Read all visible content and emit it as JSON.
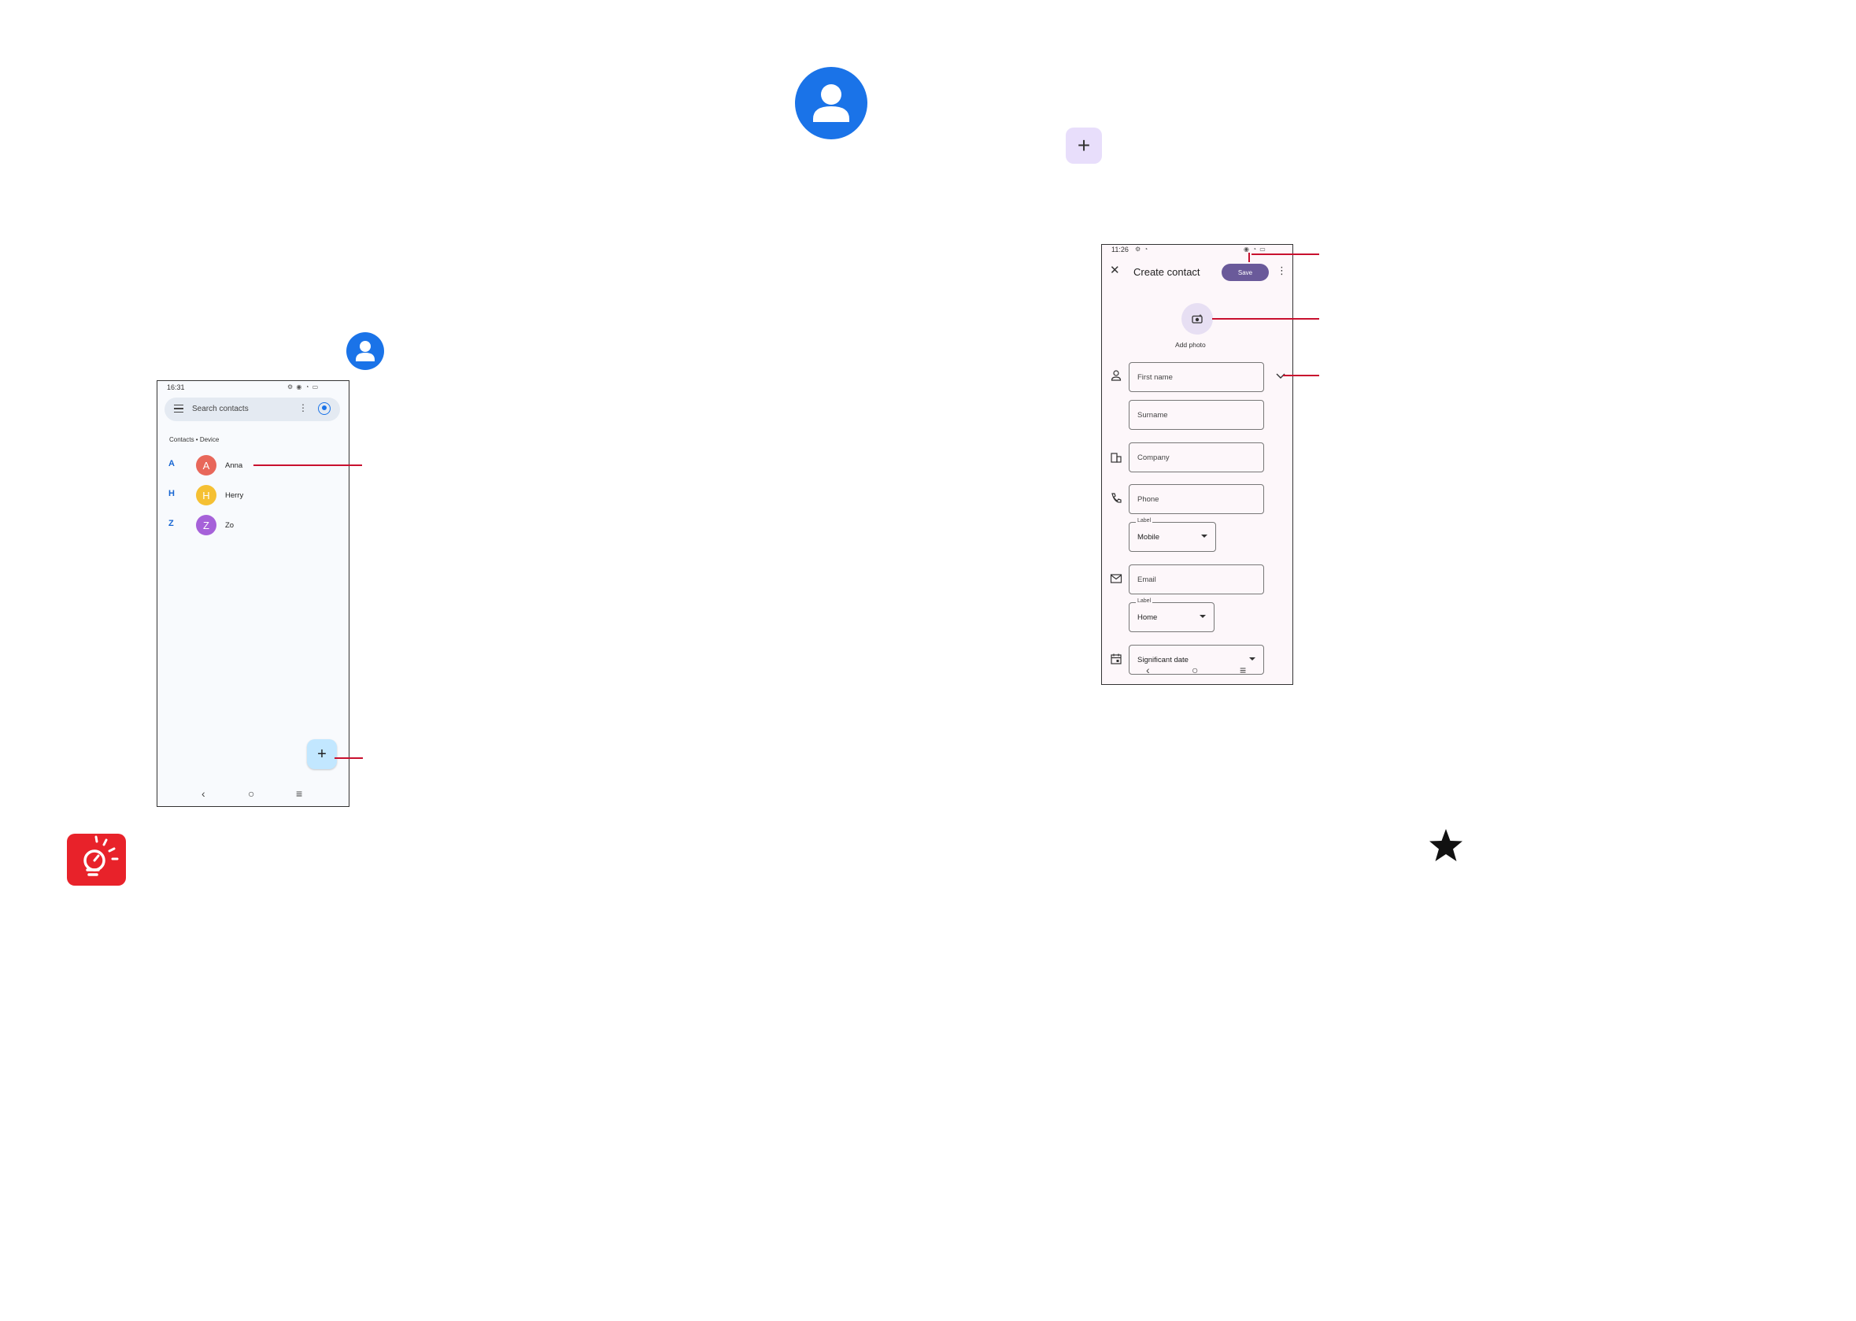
{
  "contacts_list_screen": {
    "status_time": "16:31",
    "status_icons": "⚙ ◉ ◔ ▭",
    "search_placeholder": "Search contacts",
    "more_glyph": "⋮",
    "breadcrumb": "Contacts • Device",
    "contacts": [
      {
        "letter": "A",
        "initial": "A",
        "name": "Anna",
        "color": "#e8675a"
      },
      {
        "letter": "H",
        "initial": "H",
        "name": "Herry",
        "color": "#f5c033"
      },
      {
        "letter": "Z",
        "initial": "Z",
        "name": "Zo",
        "color": "#a661d9"
      }
    ],
    "fab_glyph": "+",
    "nav": {
      "back": "‹",
      "home": "○",
      "recents": "≡"
    }
  },
  "create_contact_screen": {
    "status_time": "11:26",
    "status_left_icons": "⚙ ◔",
    "status_icons": "◉ ◔ ▭",
    "close_glyph": "✕",
    "title": "Create contact",
    "save_label": "Save",
    "more_glyph": "⋮",
    "add_photo_label": "Add photo",
    "fields": {
      "first_name": "First name",
      "surname": "Surname",
      "company": "Company",
      "phone": "Phone",
      "phone_label_caption": "Label",
      "phone_label_value": "Mobile",
      "email": "Email",
      "email_label_caption": "Label",
      "email_label_value": "Home",
      "significant_date": "Significant date"
    },
    "nav": {
      "back": "‹",
      "home": "○",
      "recents": "≡"
    }
  },
  "page_icons": {
    "add_tile_glyph": "+",
    "contacts_app_icon": "contacts-app-icon",
    "tip_icon": "lightbulb-tip-icon",
    "star_icon": "star-icon"
  },
  "colors": {
    "annotation": "#c8102e",
    "contacts_blue": "#1a73e8",
    "save_button": "#6a5a9a",
    "tip_red": "#e8222a"
  }
}
